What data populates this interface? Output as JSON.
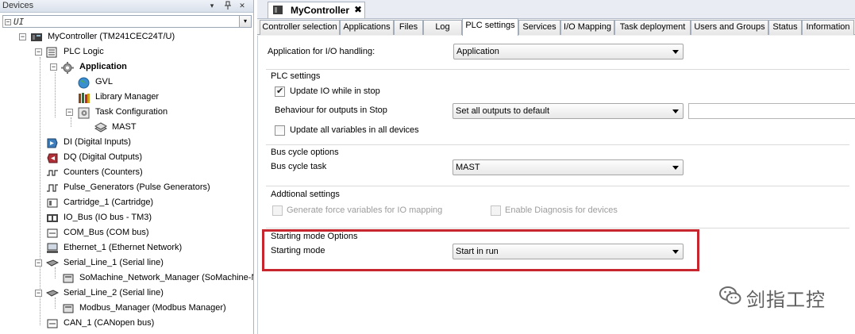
{
  "devices_pane": {
    "title": "Devices",
    "pin_glyph": "▾",
    "pushpin_glyph": "ᵖ",
    "close_glyph": "✕",
    "filter_text": "UI",
    "filter_expander": "−",
    "dropdown_glyph": "▾"
  },
  "tree": {
    "expander_minus": "−",
    "items": [
      {
        "label": "MyController (TM241CEC24T/U)",
        "icon": "controller-icon",
        "bold": false
      },
      {
        "label": "PLC Logic",
        "icon": "plc-logic-icon",
        "bold": false
      },
      {
        "label": "Application",
        "icon": "application-gear-icon",
        "bold": true
      },
      {
        "label": "GVL",
        "icon": "globe-icon",
        "bold": false
      },
      {
        "label": "Library Manager",
        "icon": "books-icon",
        "bold": false
      },
      {
        "label": "Task Configuration",
        "icon": "task-config-icon",
        "bold": false
      },
      {
        "label": "MAST",
        "icon": "task-icon",
        "bold": false
      },
      {
        "label": "DI (Digital Inputs)",
        "icon": "digital-input-icon",
        "bold": false
      },
      {
        "label": "DQ (Digital Outputs)",
        "icon": "digital-output-icon",
        "bold": false
      },
      {
        "label": "Counters (Counters)",
        "icon": "counter-icon",
        "bold": false
      },
      {
        "label": "Pulse_Generators (Pulse Generators)",
        "icon": "pulse-icon",
        "bold": false
      },
      {
        "label": "Cartridge_1 (Cartridge)",
        "icon": "cartridge-icon",
        "bold": false
      },
      {
        "label": "IO_Bus (IO bus - TM3)",
        "icon": "io-bus-icon",
        "bold": false
      },
      {
        "label": "COM_Bus (COM bus)",
        "icon": "com-bus-icon",
        "bold": false
      },
      {
        "label": "Ethernet_1 (Ethernet Network)",
        "icon": "ethernet-icon",
        "bold": false
      },
      {
        "label": "Serial_Line_1 (Serial line)",
        "icon": "serial-line-icon",
        "bold": false
      },
      {
        "label": "SoMachine_Network_Manager (SoMachine-Network Manager)",
        "icon": "network-manager-icon",
        "bold": false
      },
      {
        "label": "Serial_Line_2 (Serial line)",
        "icon": "serial-line-icon",
        "bold": false
      },
      {
        "label": "Modbus_Manager (Modbus Manager)",
        "icon": "modbus-manager-icon",
        "bold": false
      },
      {
        "label": "CAN_1 (CANopen bus)",
        "icon": "can-bus-icon",
        "bold": false
      }
    ]
  },
  "editor": {
    "document_tab": "MyController",
    "close_glyph": "✖",
    "tabs": [
      "Controller selection",
      "Applications",
      "Files",
      "Log",
      "PLC settings",
      "Services",
      "I/O Mapping",
      "Task deployment",
      "Users and Groups",
      "Status",
      "Information"
    ],
    "active_tab": "PLC settings"
  },
  "settings": {
    "app_io_label": "Application for I/O handling:",
    "app_io_value": "Application",
    "plc_section": "PLC settings",
    "update_io_label": "Update IO while in stop",
    "update_io_checked": true,
    "check_glyph": "✔",
    "behaviour_label": "Behaviour for outputs in Stop",
    "behaviour_value": "Set all outputs to default",
    "update_all_label": "Update all variables in all devices",
    "update_all_checked": false,
    "bus_section": "Bus cycle options",
    "bus_task_label": "Bus cycle task",
    "bus_task_value": "MAST",
    "additional_section": "Addtional settings",
    "force_vars_label": "Generate force variables for IO mapping",
    "diag_label": "Enable Diagnosis for devices",
    "starting_section": "Starting mode Options",
    "starting_label": "Starting mode",
    "starting_value": "Start in run"
  },
  "watermark": {
    "text": "剑指工控"
  },
  "colors": {
    "highlight": "#c8262e",
    "tab_border": "#a3acb9",
    "pane_header": "#dfe5ee"
  }
}
